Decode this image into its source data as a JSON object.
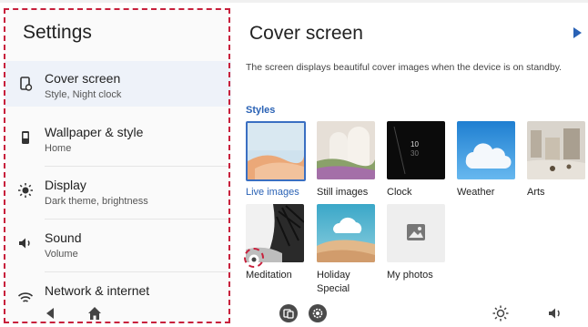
{
  "settings": {
    "title": "Settings",
    "items": [
      {
        "label": "Cover screen",
        "sub": "Style, Night clock",
        "icon": "cover-screen-icon"
      },
      {
        "label": "Wallpaper & style",
        "sub": "Home",
        "icon": "wallpaper-icon"
      },
      {
        "label": "Display",
        "sub": "Dark theme, brightness",
        "icon": "display-brightness-icon"
      },
      {
        "label": "Sound",
        "sub": "Volume",
        "icon": "sound-icon"
      },
      {
        "label": "Network & internet",
        "sub": "",
        "icon": "wifi-icon"
      }
    ]
  },
  "cover": {
    "title": "Cover screen",
    "description": "The screen displays beautiful cover images when the device is on standby.",
    "styles_label": "Styles",
    "clock_hour": "10",
    "clock_minute": "30",
    "styles": [
      {
        "label": "Live images",
        "selected": true
      },
      {
        "label": "Still images"
      },
      {
        "label": "Clock"
      },
      {
        "label": "Weather"
      },
      {
        "label": "Arts"
      },
      {
        "label": "Meditation"
      },
      {
        "label": "Holiday Special"
      },
      {
        "label": "My photos"
      }
    ]
  },
  "nav": {
    "back": "back-icon",
    "home": "home-icon",
    "screen": "cover-screen-nav-icon",
    "settings": "settings-gear-icon",
    "brightness": "brightness-icon",
    "volume": "volume-icon"
  },
  "colors": {
    "accent": "#2a62b5",
    "highlight": "#c8203c",
    "active_bg": "#eef2f9"
  }
}
